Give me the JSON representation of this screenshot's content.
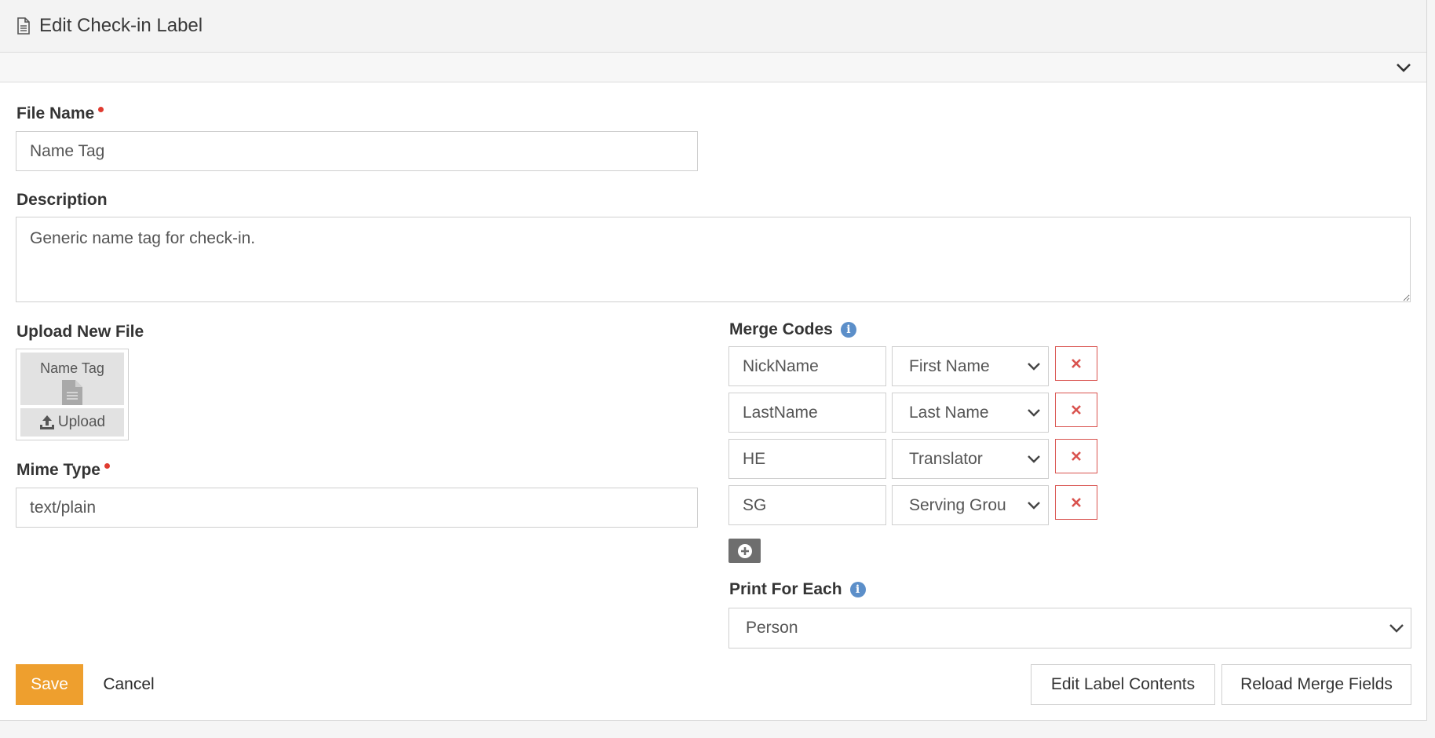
{
  "header": {
    "title": "Edit Check-in Label",
    "icon": "file-text-icon"
  },
  "form": {
    "file_name": {
      "label": "File Name",
      "value": "Name Tag"
    },
    "description": {
      "label": "Description",
      "value": "Generic name tag for check-in."
    },
    "upload": {
      "label": "Upload New File",
      "file_name": "Name Tag",
      "button_label": "Upload"
    },
    "mime_type": {
      "label": "Mime Type",
      "value": "text/plain"
    },
    "merge_codes": {
      "label": "Merge Codes",
      "rows": [
        {
          "code": "NickName",
          "field": "First Name"
        },
        {
          "code": "LastName",
          "field": "Last Name"
        },
        {
          "code": "HE",
          "field": "Translator"
        },
        {
          "code": "SG",
          "field": "Serving Grou"
        }
      ]
    },
    "print_for_each": {
      "label": "Print For Each",
      "value": "Person"
    }
  },
  "actions": {
    "save": "Save",
    "cancel": "Cancel",
    "edit_label_contents": "Edit Label Contents",
    "reload_merge_fields": "Reload Merge Fields"
  },
  "colors": {
    "primary": "#ee9f2e",
    "danger": "#d9534f",
    "required": "#e03b30",
    "info": "#5c8fc9"
  }
}
